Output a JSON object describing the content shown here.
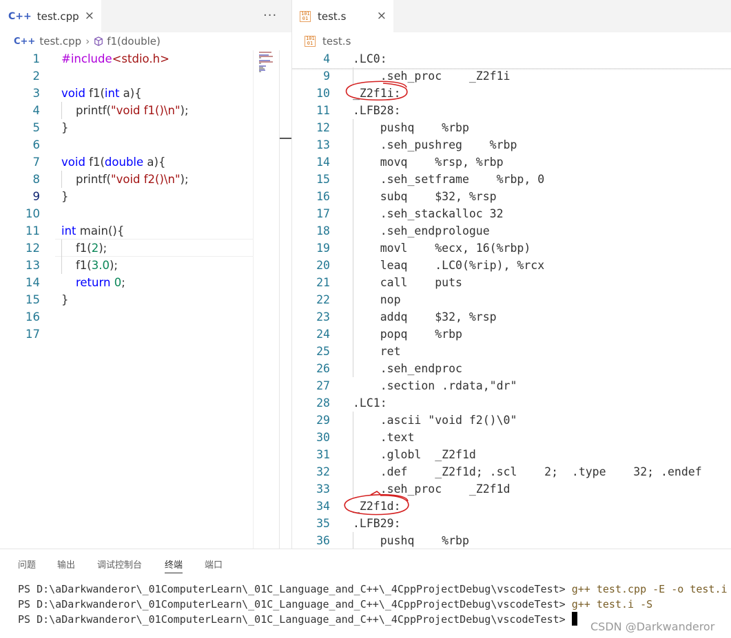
{
  "left_editor": {
    "tab": {
      "icon": "cpp-file-icon",
      "icon_text": "C++",
      "title": "test.cpp",
      "close": "×"
    },
    "more_actions": "···",
    "breadcrumb": {
      "file": "test.cpp",
      "separator": "›",
      "symbol": "f1(double)"
    },
    "current_line": 9,
    "lines": [
      {
        "no": "1",
        "code": "#include<stdio.h>"
      },
      {
        "no": "2",
        "code": ""
      },
      {
        "no": "3",
        "code": "void f1(int a){"
      },
      {
        "no": "4",
        "code": "    printf(\"void f1()\\n\");"
      },
      {
        "no": "5",
        "code": "}"
      },
      {
        "no": "6",
        "code": ""
      },
      {
        "no": "7",
        "code": "void f1(double a){"
      },
      {
        "no": "8",
        "code": "    printf(\"void f2()\\n\");"
      },
      {
        "no": "9",
        "code": "}"
      },
      {
        "no": "10",
        "code": ""
      },
      {
        "no": "11",
        "code": "int main(){"
      },
      {
        "no": "12",
        "code": "    f1(2);"
      },
      {
        "no": "13",
        "code": "    f1(3.0);"
      },
      {
        "no": "14",
        "code": "    return 0;"
      },
      {
        "no": "15",
        "code": "}"
      },
      {
        "no": "16",
        "code": ""
      },
      {
        "no": "17",
        "code": ""
      }
    ]
  },
  "right_editor": {
    "tab": {
      "icon": "asm-file-icon",
      "icon_text": "101 01",
      "title": "test.s",
      "close": "×"
    },
    "breadcrumb": {
      "file": "test.s"
    },
    "sticky": {
      "no": "4",
      "code": ".LC0:"
    },
    "lines": [
      {
        "no": "9",
        "code": "    .seh_proc    _Z2f1i"
      },
      {
        "no": "10",
        "code": "_Z2f1i:"
      },
      {
        "no": "11",
        "code": ".LFB28:"
      },
      {
        "no": "12",
        "code": "    pushq    %rbp"
      },
      {
        "no": "13",
        "code": "    .seh_pushreg    %rbp"
      },
      {
        "no": "14",
        "code": "    movq    %rsp, %rbp"
      },
      {
        "no": "15",
        "code": "    .seh_setframe    %rbp, 0"
      },
      {
        "no": "16",
        "code": "    subq    $32, %rsp"
      },
      {
        "no": "17",
        "code": "    .seh_stackalloc 32"
      },
      {
        "no": "18",
        "code": "    .seh_endprologue"
      },
      {
        "no": "19",
        "code": "    movl    %ecx, 16(%rbp)"
      },
      {
        "no": "20",
        "code": "    leaq    .LC0(%rip), %rcx"
      },
      {
        "no": "21",
        "code": "    call    puts"
      },
      {
        "no": "22",
        "code": "    nop"
      },
      {
        "no": "23",
        "code": "    addq    $32, %rsp"
      },
      {
        "no": "24",
        "code": "    popq    %rbp"
      },
      {
        "no": "25",
        "code": "    ret"
      },
      {
        "no": "26",
        "code": "    .seh_endproc"
      },
      {
        "no": "27",
        "code": "    .section .rdata,\"dr\""
      },
      {
        "no": "28",
        "code": ".LC1:"
      },
      {
        "no": "29",
        "code": "    .ascii \"void f2()\\0\""
      },
      {
        "no": "30",
        "code": "    .text"
      },
      {
        "no": "31",
        "code": "    .globl  _Z2f1d"
      },
      {
        "no": "32",
        "code": "    .def    _Z2f1d; .scl    2;  .type    32; .endef"
      },
      {
        "no": "33",
        "code": "    .seh_proc    _Z2f1d"
      },
      {
        "no": "34",
        "code": "_Z2f1d:"
      },
      {
        "no": "35",
        "code": ".LFB29:"
      },
      {
        "no": "36",
        "code": "    pushq    %rbp"
      }
    ]
  },
  "annotations": {
    "circle_color": "#d42020",
    "circled_labels": [
      "_Z2f1i:",
      "_Z2f1d:"
    ]
  },
  "panel": {
    "tabs": [
      "问题",
      "输出",
      "调试控制台",
      "终端",
      "端口"
    ],
    "active_tab": "终端",
    "terminal": [
      {
        "prompt": "PS D:\\aDarkwanderor\\_01ComputerLearn\\_01C_Language_and_C++\\_4CppProjectDebug\\vscodeTest>",
        "command": " g++ test.cpp -E -o test.i"
      },
      {
        "prompt": "PS D:\\aDarkwanderor\\_01ComputerLearn\\_01C_Language_and_C++\\_4CppProjectDebug\\vscodeTest>",
        "command": " g++ test.i -S"
      },
      {
        "prompt": "PS D:\\aDarkwanderor\\_01ComputerLearn\\_01C_Language_and_C++\\_4CppProjectDebug\\vscodeTest>",
        "command": ""
      }
    ]
  },
  "watermark": "CSDN @Darkwanderor"
}
